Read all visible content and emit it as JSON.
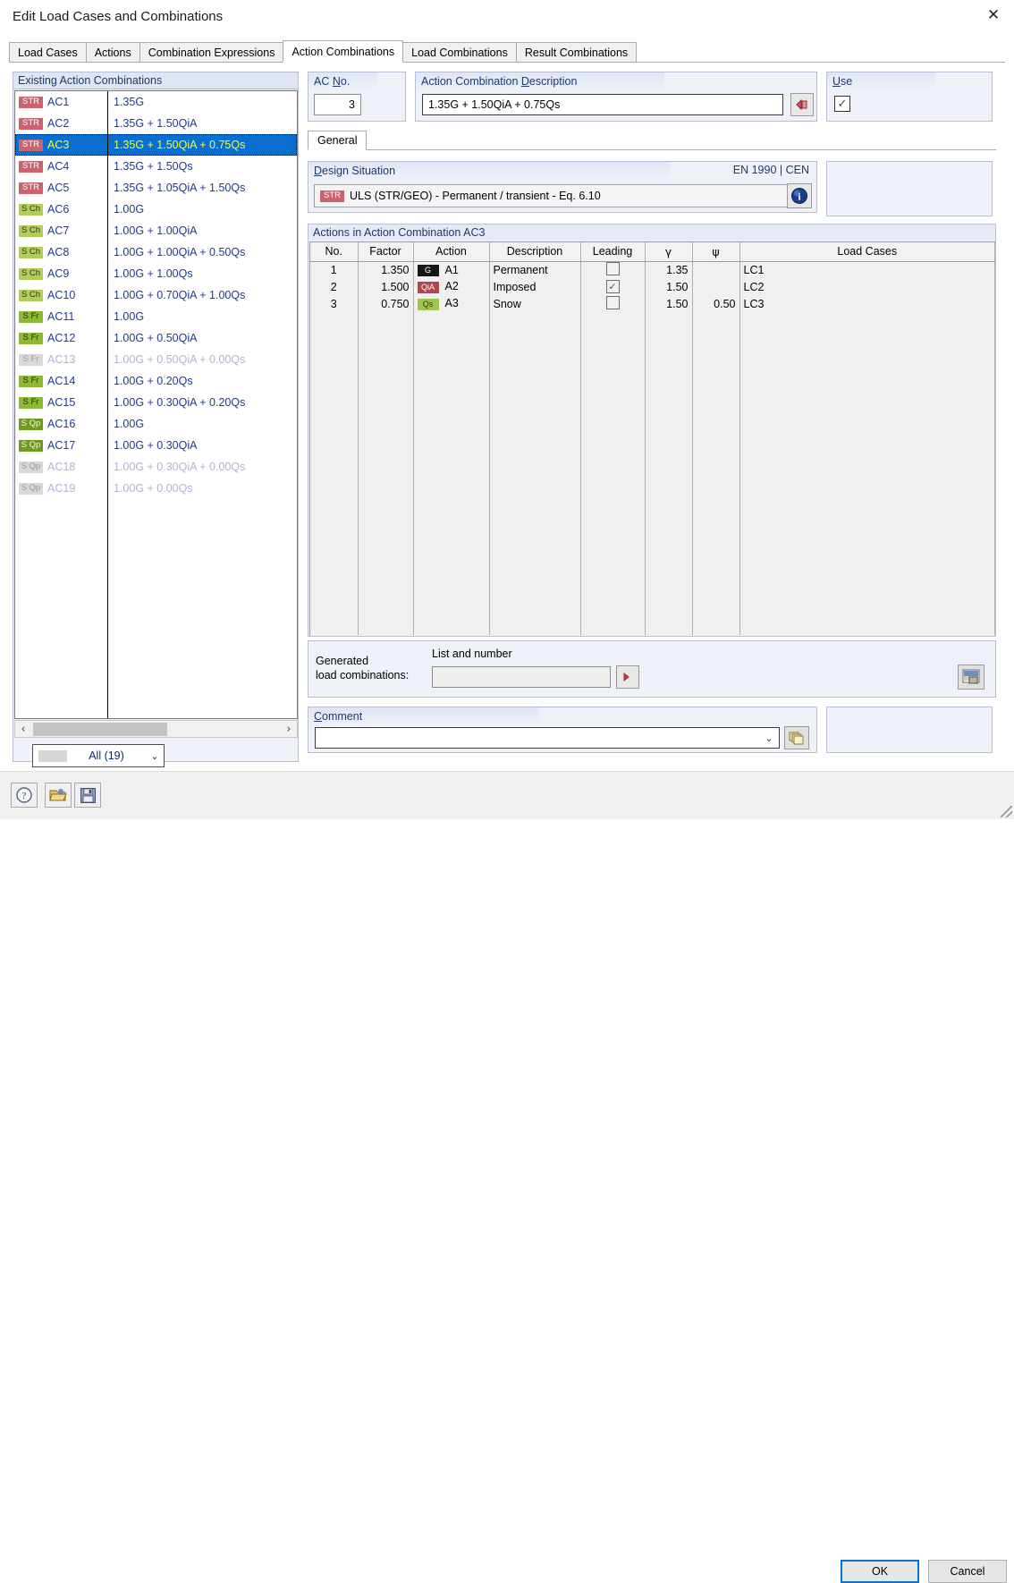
{
  "window": {
    "title": "Edit Load Cases and Combinations",
    "close_icon": "close-icon"
  },
  "tabs": [
    {
      "label": "Load Cases",
      "active": false
    },
    {
      "label": "Actions",
      "active": false
    },
    {
      "label": "Combination Expressions",
      "active": false
    },
    {
      "label": "Action Combinations",
      "active": true
    },
    {
      "label": "Load Combinations",
      "active": false
    },
    {
      "label": "Result Combinations",
      "active": false
    }
  ],
  "left_panel": {
    "title": "Existing Action Combinations",
    "rows": [
      {
        "badge": "STR",
        "badge_class": "b-str",
        "name": "AC1",
        "expr": "1.35G",
        "selected": false,
        "disabled": false
      },
      {
        "badge": "STR",
        "badge_class": "b-str",
        "name": "AC2",
        "expr": "1.35G + 1.50QiA",
        "selected": false,
        "disabled": false
      },
      {
        "badge": "STR",
        "badge_class": "b-str",
        "name": "AC3",
        "expr": "1.35G + 1.50QiA + 0.75Qs",
        "selected": true,
        "disabled": false
      },
      {
        "badge": "STR",
        "badge_class": "b-str",
        "name": "AC4",
        "expr": "1.35G + 1.50Qs",
        "selected": false,
        "disabled": false
      },
      {
        "badge": "STR",
        "badge_class": "b-str",
        "name": "AC5",
        "expr": "1.35G + 1.05QiA + 1.50Qs",
        "selected": false,
        "disabled": false
      },
      {
        "badge": "S Ch",
        "badge_class": "b-sch",
        "name": "AC6",
        "expr": "1.00G",
        "selected": false,
        "disabled": false
      },
      {
        "badge": "S Ch",
        "badge_class": "b-sch",
        "name": "AC7",
        "expr": "1.00G + 1.00QiA",
        "selected": false,
        "disabled": false
      },
      {
        "badge": "S Ch",
        "badge_class": "b-sch",
        "name": "AC8",
        "expr": "1.00G + 1.00QiA + 0.50Qs",
        "selected": false,
        "disabled": false
      },
      {
        "badge": "S Ch",
        "badge_class": "b-sch",
        "name": "AC9",
        "expr": "1.00G + 1.00Qs",
        "selected": false,
        "disabled": false
      },
      {
        "badge": "S Ch",
        "badge_class": "b-sch",
        "name": "AC10",
        "expr": "1.00G + 0.70QiA + 1.00Qs",
        "selected": false,
        "disabled": false
      },
      {
        "badge": "S Fr",
        "badge_class": "b-sfr",
        "name": "AC11",
        "expr": "1.00G",
        "selected": false,
        "disabled": false
      },
      {
        "badge": "S Fr",
        "badge_class": "b-sfr",
        "name": "AC12",
        "expr": "1.00G + 0.50QiA",
        "selected": false,
        "disabled": false
      },
      {
        "badge": "S Fr",
        "badge_class": "b-dis",
        "name": "AC13",
        "expr": "1.00G + 0.50QiA + 0.00Qs",
        "selected": false,
        "disabled": true
      },
      {
        "badge": "S Fr",
        "badge_class": "b-sfr",
        "name": "AC14",
        "expr": "1.00G + 0.20Qs",
        "selected": false,
        "disabled": false
      },
      {
        "badge": "S Fr",
        "badge_class": "b-sfr",
        "name": "AC15",
        "expr": "1.00G + 0.30QiA + 0.20Qs",
        "selected": false,
        "disabled": false
      },
      {
        "badge": "S Qp",
        "badge_class": "b-sqp",
        "name": "AC16",
        "expr": "1.00G",
        "selected": false,
        "disabled": false
      },
      {
        "badge": "S Qp",
        "badge_class": "b-sqp",
        "name": "AC17",
        "expr": "1.00G + 0.30QiA",
        "selected": false,
        "disabled": false
      },
      {
        "badge": "S Qp",
        "badge_class": "b-dis",
        "name": "AC18",
        "expr": "1.00G + 0.30QiA + 0.00Qs",
        "selected": false,
        "disabled": true
      },
      {
        "badge": "S Qp",
        "badge_class": "b-dis",
        "name": "AC19",
        "expr": "1.00G + 0.00Qs",
        "selected": false,
        "disabled": true
      }
    ],
    "filter": {
      "label": "All (19)",
      "arrow_icon": "chevron-down-icon"
    },
    "scroll": {
      "left_icon": "chevron-left-icon",
      "right_icon": "chevron-right-icon"
    }
  },
  "ac_no": {
    "legend_pre": "AC ",
    "legend_mnemonic": "N",
    "legend_post": "o.",
    "value": "3"
  },
  "description": {
    "legend_pre": "Action Combination ",
    "legend_mnemonic": "D",
    "legend_post": "escription",
    "value": "1.35G + 1.50QiA + 0.75Qs",
    "button_icon": "red-left-arrow-icon"
  },
  "use": {
    "legend_mnemonic": "U",
    "legend_post": "se",
    "checked": true,
    "check_glyph": "✓"
  },
  "general_tab": {
    "label": "General"
  },
  "design_situation": {
    "legend_mnemonic": "D",
    "legend_post": "esign Situation",
    "standard": "EN 1990 | CEN",
    "badge": "STR",
    "value": "ULS (STR/GEO) - Permanent / transient - Eq. 6.10",
    "info_icon": "info-icon",
    "info_glyph": "i"
  },
  "actions_table": {
    "title": "Actions in Action Combination AC3",
    "columns": [
      "No.",
      "Factor",
      "Action",
      "Description",
      "Leading",
      "γ",
      "ψ",
      "Load Cases"
    ],
    "rows": [
      {
        "no": "1",
        "factor": "1.350",
        "action_badge": "G",
        "action_badge_class": "ab-g",
        "action": "A1",
        "description": "Permanent",
        "leading": false,
        "gamma": "1.35",
        "psi": "",
        "load_cases": "LC1"
      },
      {
        "no": "2",
        "factor": "1.500",
        "action_badge": "QiA",
        "action_badge_class": "ab-q",
        "action": "A2",
        "description": "Imposed",
        "leading": true,
        "gamma": "1.50",
        "psi": "",
        "load_cases": "LC2"
      },
      {
        "no": "3",
        "factor": "0.750",
        "action_badge": "Qs",
        "action_badge_class": "ab-s",
        "action": "A3",
        "description": "Snow",
        "leading": false,
        "gamma": "1.50",
        "psi": "0.50",
        "load_cases": "LC3"
      }
    ],
    "check_glyph": "✓"
  },
  "generated": {
    "label_line1": "Generated",
    "label_line2": "load combinations:",
    "sublabel": "List and number",
    "value": "",
    "go_icon": "red-right-arrow-icon",
    "picture_icon": "picture-icon"
  },
  "comment": {
    "legend_mnemonic": "C",
    "legend_post": "omment",
    "value": "",
    "arrow_icon": "chevron-down-icon",
    "button_icon": "copy-icon"
  },
  "footer": {
    "help_icon": "help-icon",
    "open_icon": "open-folder-icon",
    "save_icon": "save-icon",
    "ok_label": "OK",
    "cancel_label": "Cancel"
  }
}
